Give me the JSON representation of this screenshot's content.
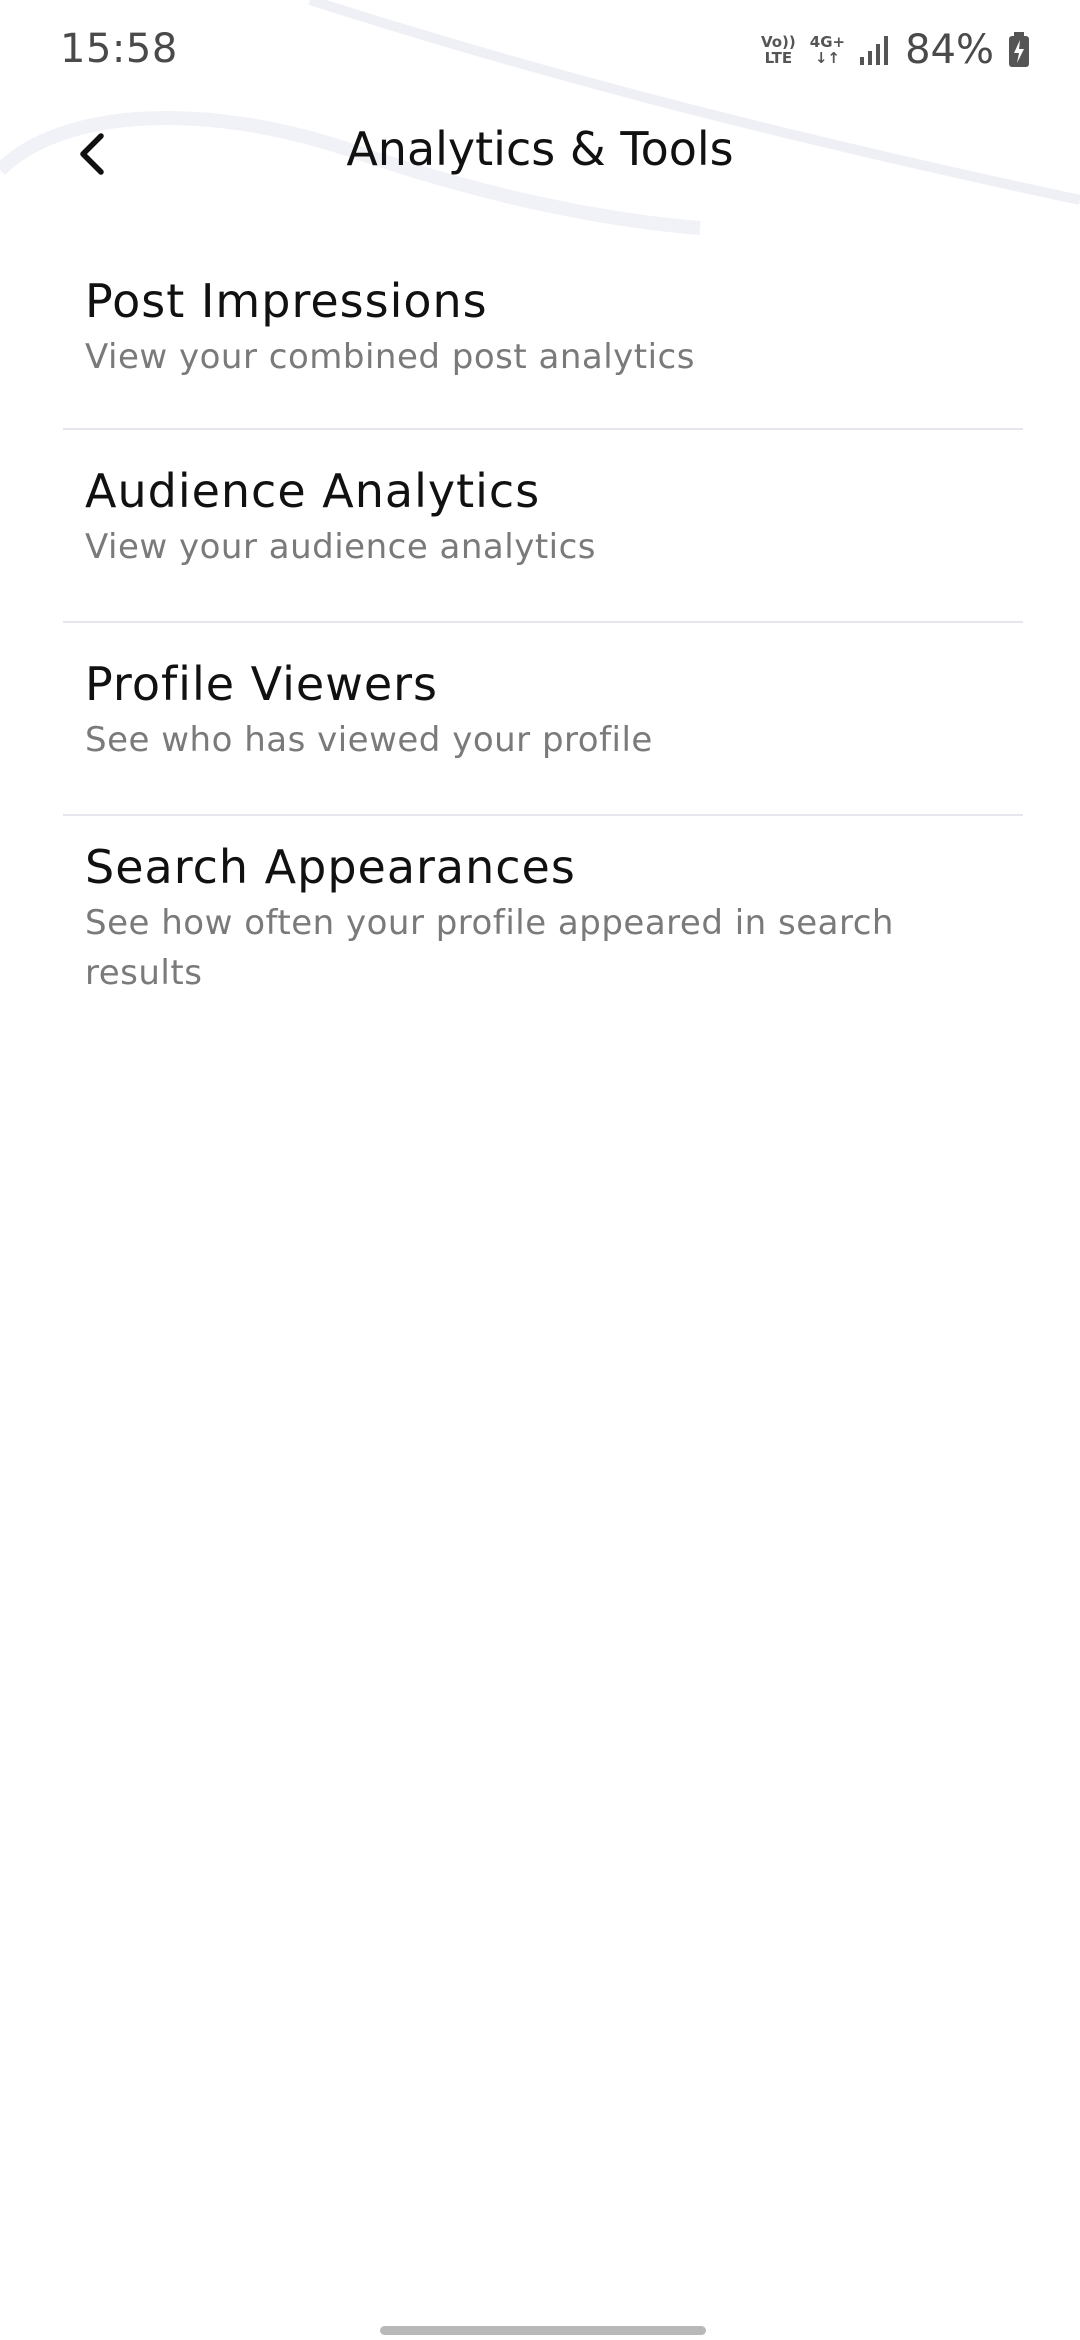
{
  "status_bar": {
    "time": "15:58",
    "volte_top": "Vo))",
    "volte_bottom": "LTE",
    "network_top": "4G+",
    "network_bottom": "↓↑",
    "battery": "84%"
  },
  "header": {
    "title": "Analytics & Tools",
    "back_icon": "chevron-left-icon"
  },
  "menu": {
    "items": [
      {
        "title": "Post Impressions",
        "subtitle": "View your combined post analytics"
      },
      {
        "title": "Audience Analytics",
        "subtitle": "View your audience analytics"
      },
      {
        "title": "Profile Viewers",
        "subtitle": "See who has viewed your profile"
      },
      {
        "title": "Search Appearances",
        "subtitle": "See how often your profile appeared in search results"
      }
    ]
  },
  "colors": {
    "title_text": "#111111",
    "subtitle_text": "#7a7a7a",
    "divider": "#e6e6ec",
    "background": "#ffffff"
  }
}
